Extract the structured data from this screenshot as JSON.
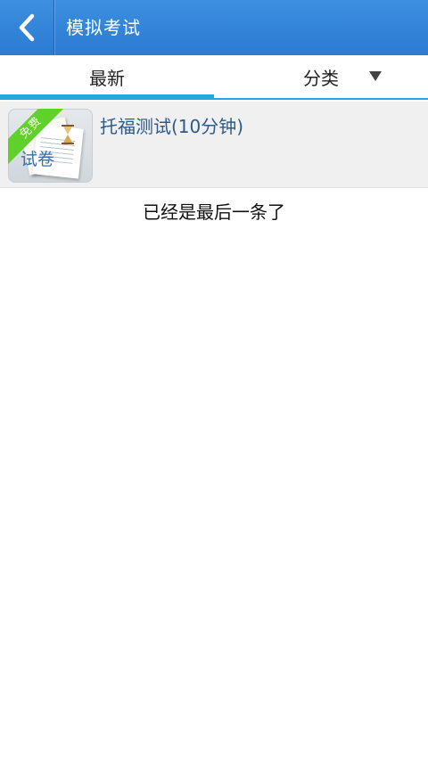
{
  "header": {
    "title": "模拟考试"
  },
  "tabs": [
    {
      "label": "最新",
      "selected": true
    },
    {
      "label": "分类",
      "selected": false
    }
  ],
  "list": {
    "items": [
      {
        "title": "托福测试(10分钟)",
        "thumbnail": {
          "ribbon": "免费",
          "label": "试卷"
        }
      }
    ]
  },
  "status": {
    "end_message": "已经是最后一条了"
  },
  "colors": {
    "header_bg": "#2a7bd2",
    "tab_indicator": "#28a8d6",
    "ribbon_green": "#5fd12a",
    "item_title": "#2d5a8a"
  },
  "icons": {
    "back": "chevron-left-icon",
    "dropdown": "triangle-down-icon"
  }
}
